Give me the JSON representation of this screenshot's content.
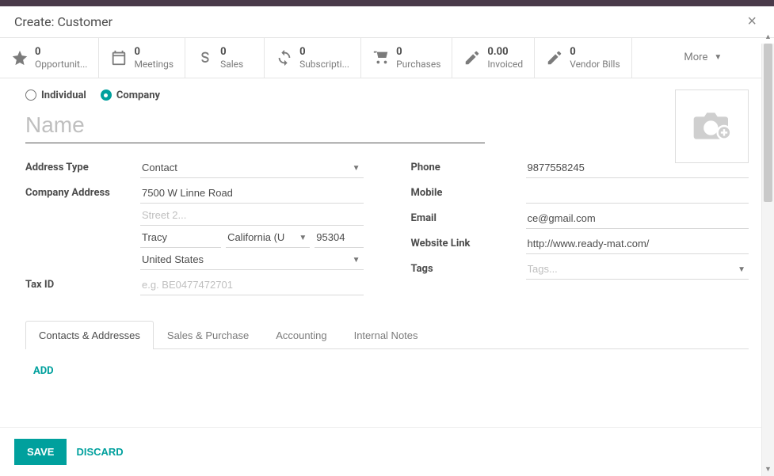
{
  "modal": {
    "title": "Create: Customer"
  },
  "stats": [
    {
      "icon": "star",
      "value": "0",
      "label": "Opportunit..."
    },
    {
      "icon": "calendar",
      "value": "0",
      "label": "Meetings"
    },
    {
      "icon": "dollar",
      "value": "0",
      "label": "Sales"
    },
    {
      "icon": "refresh",
      "value": "0",
      "label": "Subscripti..."
    },
    {
      "icon": "cart",
      "value": "0",
      "label": "Purchases"
    },
    {
      "icon": "pencil",
      "value": "0.00",
      "label": "Invoiced"
    },
    {
      "icon": "pencil",
      "value": "0",
      "label": "Vendor Bills"
    }
  ],
  "more_label": "More",
  "type_radios": {
    "individual": "Individual",
    "company": "Company",
    "selected": "company"
  },
  "name_placeholder": "Name",
  "left": {
    "address_type": {
      "label": "Address Type",
      "value": "Contact"
    },
    "company_address": {
      "label": "Company Address",
      "street1": "7500 W Linne Road",
      "street2_placeholder": "Street 2...",
      "city": "Tracy",
      "state": "California (U",
      "zip": "95304",
      "country": "United States"
    },
    "tax_id": {
      "label": "Tax ID",
      "placeholder": "e.g. BE0477472701"
    }
  },
  "right": {
    "phone": {
      "label": "Phone",
      "value": "9877558245"
    },
    "mobile": {
      "label": "Mobile",
      "value": ""
    },
    "email": {
      "label": "Email",
      "value": "ce@gmail.com"
    },
    "website": {
      "label": "Website Link",
      "value": "http://www.ready-mat.com/"
    },
    "tags": {
      "label": "Tags",
      "placeholder": "Tags..."
    }
  },
  "tabs": {
    "items": [
      "Contacts & Addresses",
      "Sales & Purchase",
      "Accounting",
      "Internal Notes"
    ],
    "active": 0,
    "add_label": "ADD"
  },
  "footer": {
    "save": "SAVE",
    "discard": "DISCARD"
  }
}
